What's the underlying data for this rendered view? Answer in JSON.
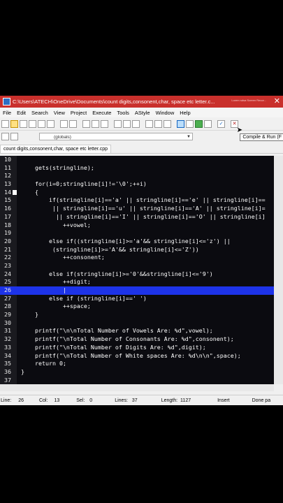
{
  "window": {
    "title": "C:\\Users\\ATECH\\OneDrive\\Documents\\count digits,consonent,char, space etc letter.c...",
    "watermark": "Lorem sdsa Screen Recor...",
    "close_glyph": "✕"
  },
  "menu": [
    "File",
    "Edit",
    "Search",
    "View",
    "Project",
    "Execute",
    "Tools",
    "AStyle",
    "Window",
    "Help"
  ],
  "toolbar2": {
    "scope": "(globals)"
  },
  "tooltip": "Compile & Run (F",
  "tab": "count digits,consonent,char, space etc letter.cpp",
  "editor": {
    "lines": [
      {
        "n": "10",
        "text": ""
      },
      {
        "n": "11",
        "text": "    gets(stringline);"
      },
      {
        "n": "12",
        "text": ""
      },
      {
        "n": "13",
        "text": "    for(i=0;stringline[i]!='\\0';++i)"
      },
      {
        "n": "14",
        "text": "    {"
      },
      {
        "n": "15",
        "text": "        if(stringline[i]=='a' || stringline[i]=='e' || stringline[i]=="
      },
      {
        "n": "16",
        "text": "         || stringline[i]=='u' || stringline[i]=='A' || stringline[i]="
      },
      {
        "n": "17",
        "text": "          || stringline[i]=='I' || stringline[i]=='O' || stringline[i]"
      },
      {
        "n": "18",
        "text": "            ++vowel;"
      },
      {
        "n": "19",
        "text": ""
      },
      {
        "n": "20",
        "text": "        else if((stringline[i]>='a'&& stringline[i]<='z') ||"
      },
      {
        "n": "21",
        "text": "         (stringline[i]>='A'&& stringline[i]<='Z'))"
      },
      {
        "n": "22",
        "text": "            ++consonent;"
      },
      {
        "n": "23",
        "text": ""
      },
      {
        "n": "24",
        "text": "        else if(stringline[i]>='0'&&stringline[i]<='9')"
      },
      {
        "n": "25",
        "text": "            ++digit;"
      },
      {
        "n": "26",
        "text": "            |"
      },
      {
        "n": "27",
        "text": "        else if (stringline[i]==' ')"
      },
      {
        "n": "28",
        "text": "            ++space;"
      },
      {
        "n": "29",
        "text": "    }"
      },
      {
        "n": "30",
        "text": ""
      },
      {
        "n": "31",
        "text": "    printf(\"\\n\\nTotal Number of Vowels Are: %d\",vowel);"
      },
      {
        "n": "32",
        "text": "    printf(\"\\nTotal Number of Consonants Are: %d\",consonent);"
      },
      {
        "n": "33",
        "text": "    printf(\"\\nTotal Number of Digits Are: %d\",digit);"
      },
      {
        "n": "34",
        "text": "    printf(\"\\nTotal Number of White spaces Are: %d\\n\\n\",space);"
      },
      {
        "n": "35",
        "text": "    return 0;"
      },
      {
        "n": "36",
        "text": "}"
      },
      {
        "n": "37",
        "text": ""
      }
    ],
    "highlighted_line": "26",
    "bookmark_line": "14"
  },
  "status": {
    "line_label": "Line:",
    "line": "26",
    "col_label": "Col:",
    "col": "13",
    "sel_label": "Sel:",
    "sel": "0",
    "lines_label": "Lines:",
    "lines": "37",
    "length_label": "Length:",
    "length": "1127",
    "mode": "Insert",
    "msg": "Done pa"
  }
}
